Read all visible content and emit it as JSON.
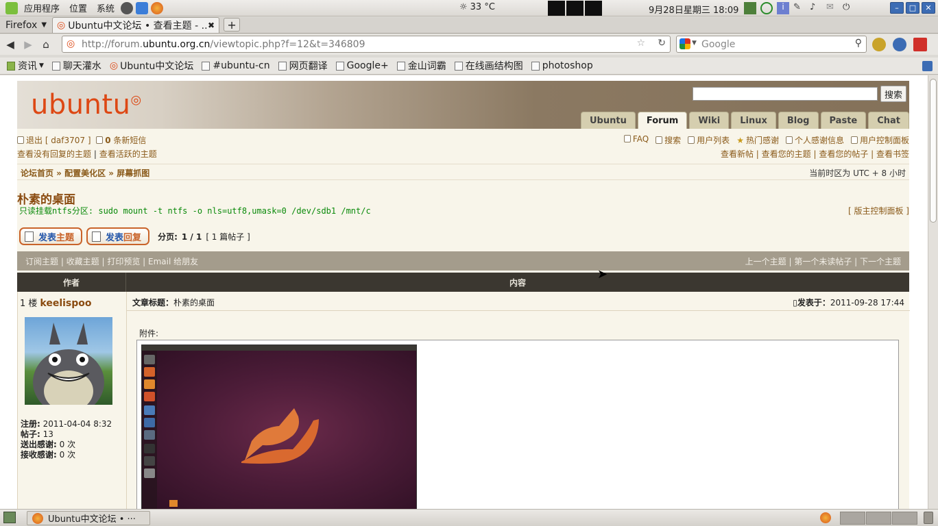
{
  "panel": {
    "menus": [
      "应用程序",
      "位置",
      "系统"
    ],
    "weather": "33 °C",
    "clock": "9月28日星期三 18:09"
  },
  "browser": {
    "menu_label": "Firefox",
    "tab_title": "Ubuntu中文论坛 • 查看主题 - ...",
    "url_prefix": "http://forum.",
    "url_domain": "ubuntu.org.cn",
    "url_suffix": "/viewtopic.php?f=12&t=346809",
    "search_placeholder": "Google",
    "bookmarks": [
      "资讯",
      "聊天灌水",
      "Ubuntu中文论坛",
      "#ubuntu-cn",
      "网页翻译",
      "Google+",
      "金山词霸",
      "在线画结构图",
      "photoshop"
    ]
  },
  "site": {
    "logo": "ubuntu",
    "search_button": "搜索",
    "tabs": [
      "Ubuntu",
      "Forum",
      "Wiki",
      "Linux",
      "Blog",
      "Paste",
      "Chat"
    ],
    "active_tab": "Forum",
    "logout": "退出 [ daf3707 ]",
    "pm_count": "0",
    "pm_label": "条新短信",
    "unanswered": "查看没有回复的主题",
    "active": "查看活跃的主题",
    "right_links": [
      "FAQ",
      "搜索",
      "用户列表",
      "热门感谢",
      "个人感谢信息",
      "用户控制面板"
    ],
    "view_links": "查看新帖 | 查看您的主题 | 查看您的帖子 | 查看书签",
    "breadcrumb": "论坛首页 » 配置美化区 » 屏幕抓图",
    "timezone": "当前时区为 UTC + 8 小时"
  },
  "topic": {
    "title": "朴素的桌面",
    "description": "只读挂载ntfs分区: sudo mount -t ntfs -o nls=utf8,umask=0 /dev/sdb1 /mnt/c",
    "mod_panel": "[ 版主控制面板 ]",
    "new_topic_a": "发表",
    "new_topic_b": "主题",
    "reply_a": "发表",
    "reply_b": "回复",
    "paging_label": "分页:",
    "paging_value": "1 / 1",
    "post_count": "[ 1 篇帖子 ]",
    "tools_left": "订阅主题 | 收藏主题 | 打印预览 | Email 给朋友",
    "tools_right": "上一个主题 | 第一个未读帖子 | 下一个主题",
    "col_author": "作者",
    "col_content": "内容"
  },
  "post": {
    "floor": "1 楼",
    "author": "keelispoo",
    "subject_label": "文章标题：",
    "subject": "朴素的桌面",
    "date_label": "发表于：",
    "date": "2011-09-28 17:44",
    "attachment_label": "附件:",
    "stats": [
      {
        "label": "注册:",
        "value": "2011-04-04 8:32"
      },
      {
        "label": "帖子:",
        "value": "13"
      },
      {
        "label": "送出感谢:",
        "value": "0 次"
      },
      {
        "label": "接收感谢:",
        "value": "0 次"
      }
    ]
  },
  "taskbar": {
    "window_title": "Ubuntu中文论坛 • ···"
  }
}
